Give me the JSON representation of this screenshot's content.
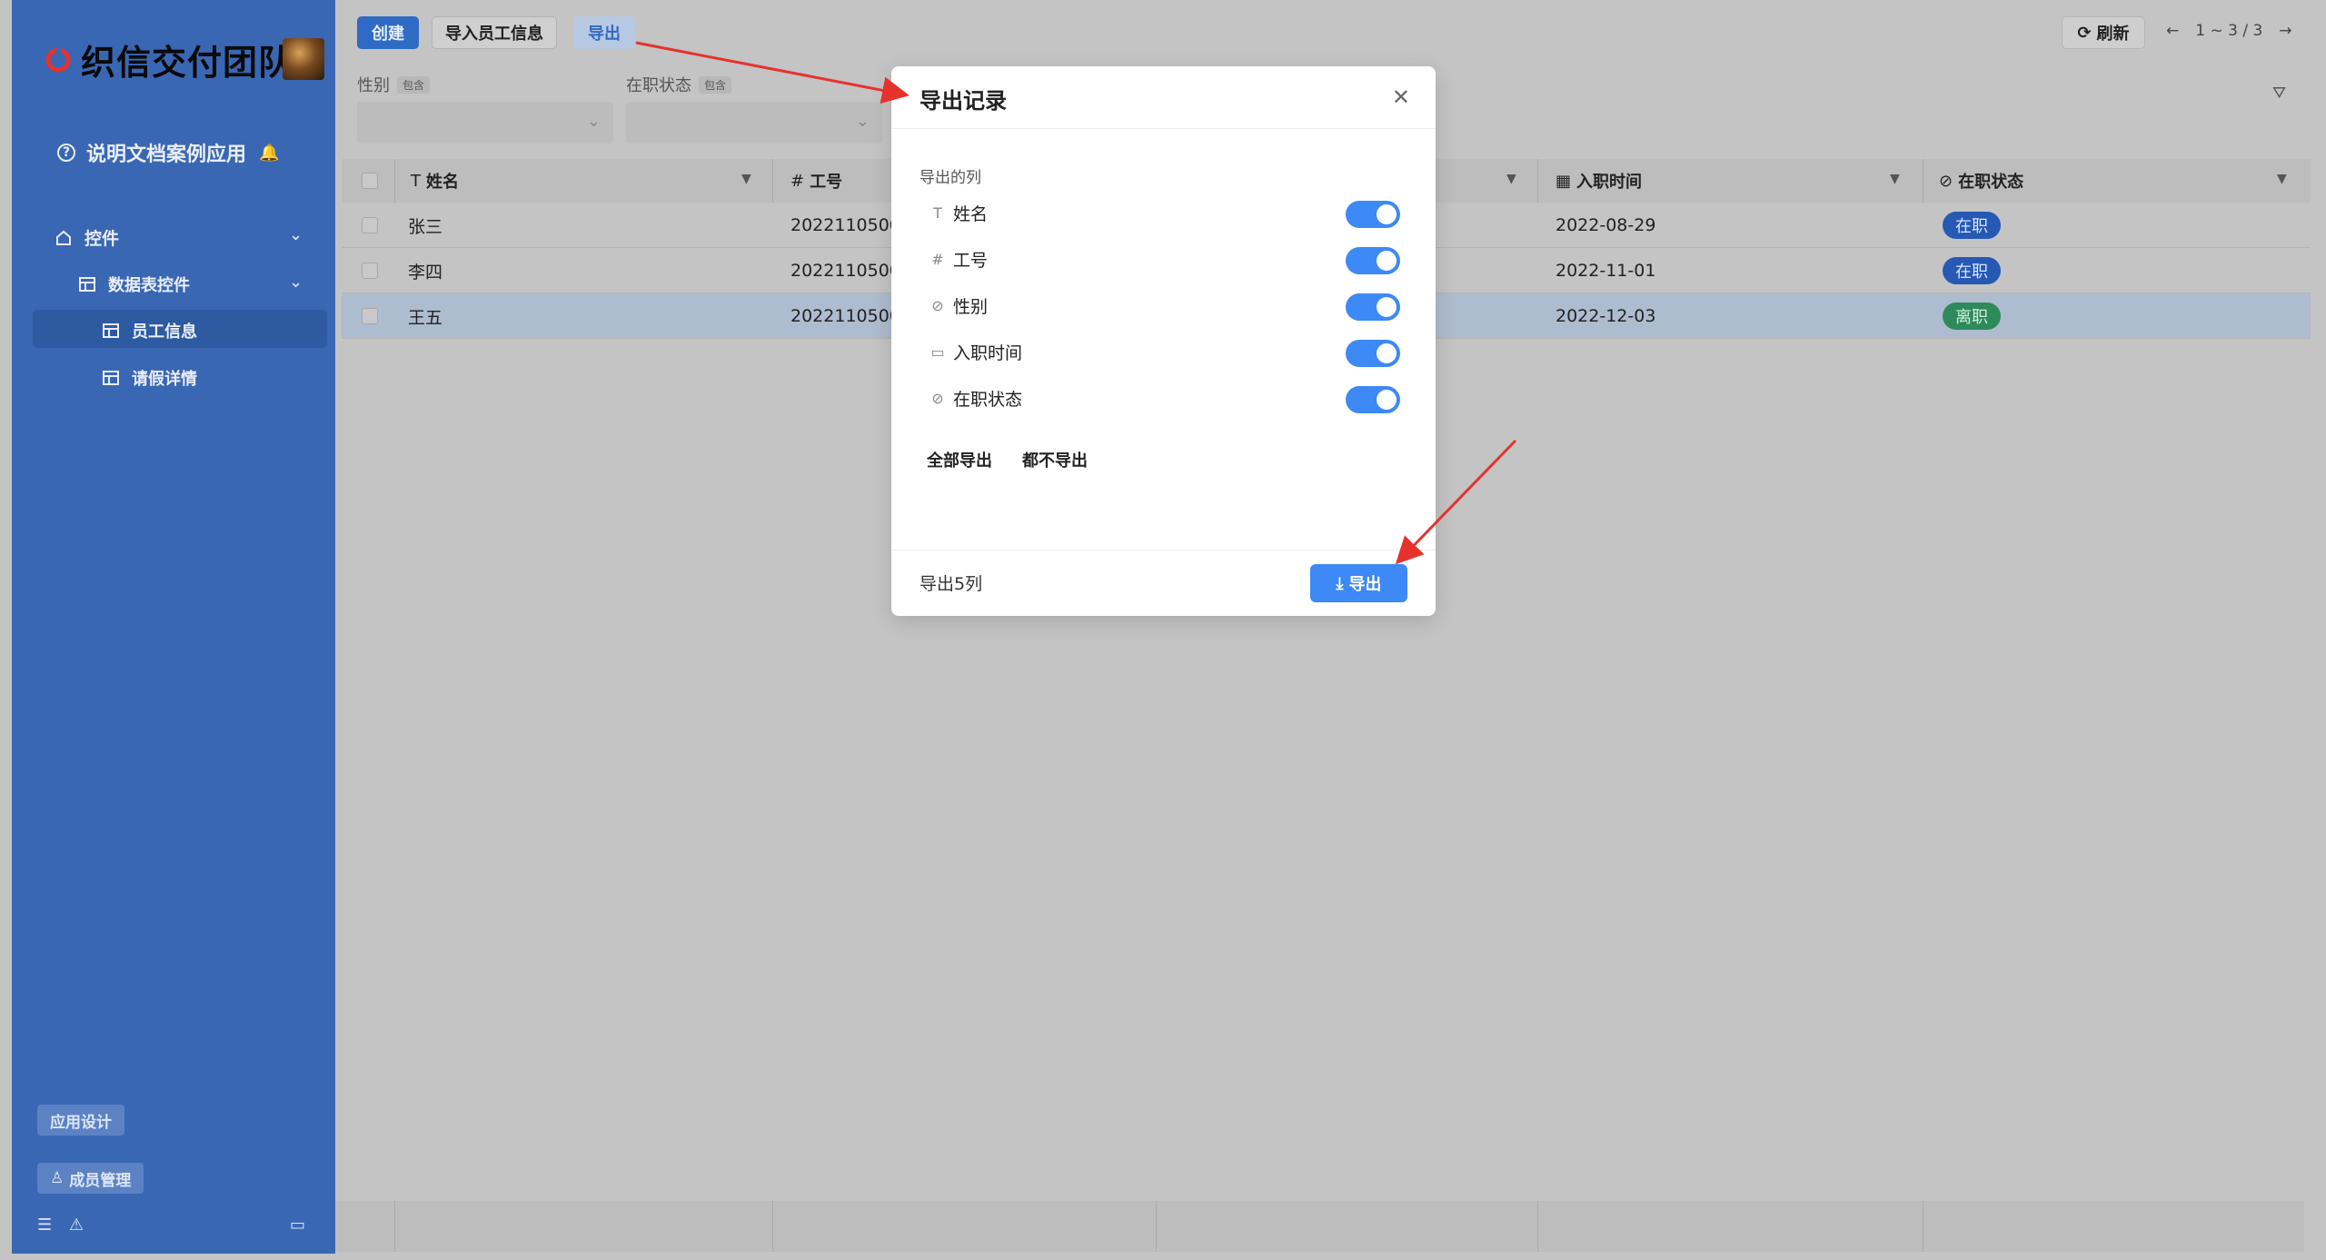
{
  "sidebar": {
    "brand": "织信交付团队",
    "app_title": "说明文档案例应用",
    "nav": {
      "controls": "控件",
      "table_controls": "数据表控件",
      "employee_info": "员工信息",
      "leave_detail": "请假详情"
    },
    "app_design": "应用设计",
    "member_manage": "成员管理"
  },
  "toolbar": {
    "create": "创建",
    "import": "导入员工信息",
    "export": "导出",
    "refresh": "刷新",
    "pager": "1 ~ 3 / 3"
  },
  "filters": {
    "gender": "性别",
    "status": "在职状态",
    "contains": "包含"
  },
  "table": {
    "headers": [
      "姓名",
      "工号",
      "入职时间",
      "在职状态"
    ],
    "rows": [
      {
        "name": "张三",
        "id": "2022110500",
        "date": "2022-08-29",
        "status": "在职"
      },
      {
        "name": "李四",
        "id": "2022110500",
        "date": "2022-11-01",
        "status": "在职"
      },
      {
        "name": "王五",
        "id": "2022110500",
        "date": "2022-12-03",
        "status": "离职"
      }
    ]
  },
  "modal": {
    "title": "导出记录",
    "section_label": "导出的列",
    "columns": [
      {
        "label": "姓名",
        "icon": "text-icon",
        "enabled": true
      },
      {
        "label": "工号",
        "icon": "hash-icon",
        "enabled": true
      },
      {
        "label": "性别",
        "icon": "check-circle-icon",
        "enabled": true
      },
      {
        "label": "入职时间",
        "icon": "calendar-icon",
        "enabled": true
      },
      {
        "label": "在职状态",
        "icon": "check-circle-icon",
        "enabled": true
      }
    ],
    "export_all": "全部导出",
    "export_none": "都不导出",
    "footer_count": "导出5列",
    "export_button": "导出"
  },
  "colors": {
    "sidebar": "#3a67b4",
    "primary": "#3d89f5",
    "arrow": "#e5322d"
  }
}
